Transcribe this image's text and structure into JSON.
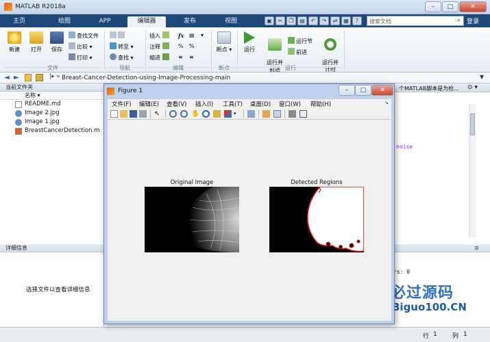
{
  "window": {
    "title": "MATLAB R2018a"
  },
  "tabs": [
    {
      "label": "主页",
      "active": false
    },
    {
      "label": "绘图",
      "active": false
    },
    {
      "label": "APP",
      "active": false
    },
    {
      "label": "编辑器",
      "active": true
    },
    {
      "label": "发布",
      "active": false
    },
    {
      "label": "视图",
      "active": false
    }
  ],
  "search": {
    "placeholder": "搜索文档"
  },
  "login_label": "登录",
  "ribbon": {
    "file": {
      "new": "新建",
      "open": "打开",
      "save": "保存",
      "find_files": "查找文件",
      "compare": "比较",
      "print": "打印",
      "group": "文件"
    },
    "navigate": {
      "goto": "转至",
      "find": "查找",
      "group": "导航"
    },
    "edit": {
      "insert": "插入",
      "comment": "注释",
      "indent": "缩进",
      "fx": "fx",
      "group": "编辑"
    },
    "breakpoints": {
      "label": "断点",
      "group": "断点"
    },
    "run": {
      "run": "运行",
      "run_advance": "运行并\n前进",
      "run_section": "运行节",
      "advance": "前进",
      "run_time": "运行并\n计时",
      "group": "运行"
    }
  },
  "address": {
    "path": "Breast-Cancer-Detection-using-Image-Processing-main"
  },
  "current_folder": {
    "title": "当前文件夹",
    "column": "名称 ▾",
    "files": [
      {
        "name": "README.md",
        "type": "md"
      },
      {
        "name": "Image 2.jpg",
        "type": "jpg"
      },
      {
        "name": "Image 1.jpg",
        "type": "jpg"
      },
      {
        "name": "BreastCancerDetection.m",
        "type": "m"
      }
    ]
  },
  "details": {
    "title": "详细信息",
    "message": "选择文件以查看详细信息"
  },
  "editor": {
    "snippet_top": "个MATLAB脚本是为检...",
    "snippet_noise": "noise"
  },
  "command": {
    "snippet": "rs: 0"
  },
  "status": {
    "row_label": "行",
    "row": "1",
    "col_label": "列",
    "col": "1"
  },
  "figure": {
    "title": "Figure 1",
    "menus": [
      "文件(F)",
      "编辑(E)",
      "查看(V)",
      "插入(I)",
      "工具(T)",
      "桌面(D)",
      "窗口(W)",
      "帮助(H)"
    ],
    "subplots": [
      {
        "title": "Original Image"
      },
      {
        "title": "Detected Regions"
      }
    ]
  },
  "watermark": {
    "cn": "必过源码",
    "en": "Biguo100.CN"
  },
  "colors": {
    "tab_bar": "#1e4878",
    "detect_outline": "#e0101a"
  }
}
